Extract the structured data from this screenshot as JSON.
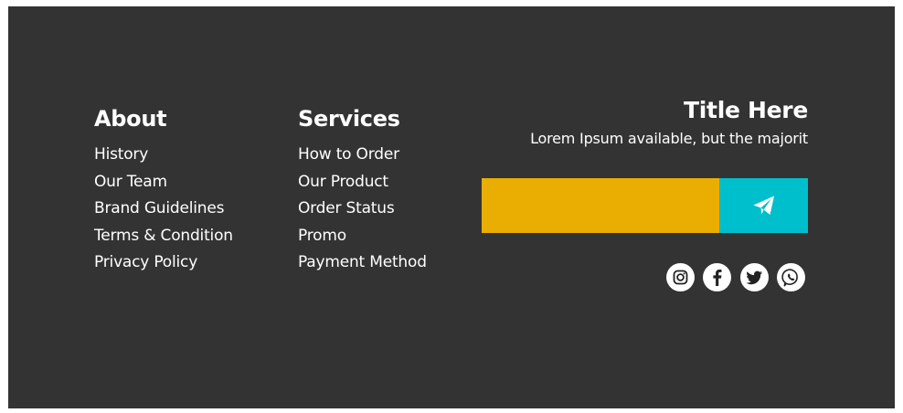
{
  "about": {
    "heading": "About",
    "links": [
      "History",
      "Our Team",
      "Brand Guidelines",
      "Terms & Condition",
      "Privacy Policy"
    ]
  },
  "services": {
    "heading": "Services",
    "links": [
      "How to Order",
      "Our Product",
      "Order Status",
      "Promo",
      "Payment Method"
    ]
  },
  "newsletter": {
    "title": "Title Here",
    "text": "Lorem Ipsum available, but the majorit",
    "input_value": "",
    "button_icon": "send-icon"
  },
  "social": [
    "instagram-icon",
    "facebook-icon",
    "twitter-icon",
    "whatsapp-icon"
  ],
  "colors": {
    "footer_bg": "#333333",
    "input_bg": "#eaad01",
    "button_bg": "#00bfcc",
    "text": "#ffffff"
  }
}
